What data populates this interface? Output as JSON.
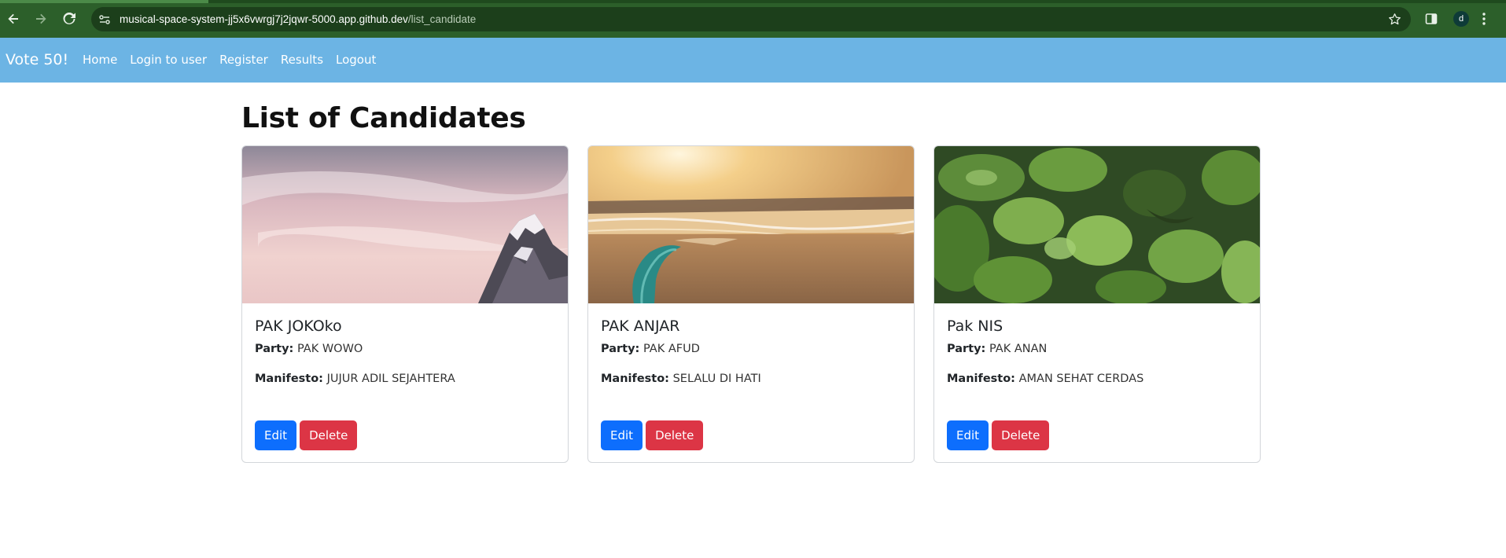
{
  "browser": {
    "url_host": "musical-space-system-jj5x6vwrgj7j2jqwr-5000.app.github.dev",
    "url_path": "/list_candidate",
    "profile_initial": "d",
    "icons": [
      "back-arrow-icon",
      "forward-arrow-icon",
      "reload-icon",
      "site-settings-icon",
      "bookmark-star-icon",
      "side-panel-icon",
      "kebab-menu-icon"
    ]
  },
  "navbar": {
    "brand": "Vote 50!",
    "links": [
      "Home",
      "Login to user",
      "Register",
      "Results",
      "Logout"
    ]
  },
  "page": {
    "title": "List of Candidates"
  },
  "labels": {
    "party": "Party:",
    "manifesto": "Manifesto:",
    "edit": "Edit",
    "delete": "Delete"
  },
  "candidates": [
    {
      "name": "PAK JOKOko",
      "party": "PAK WOWO",
      "manifesto": "JUJUR ADIL SEJAHTERA",
      "image": "snowy-mountain-pink-sky"
    },
    {
      "name": "PAK ANJAR",
      "party": "PAK AFUD",
      "manifesto": "SELALU DI HATI",
      "image": "beach-sunset-surfboard"
    },
    {
      "name": "Pak NIS",
      "party": "PAK ANAN",
      "manifesto": "AMAN SEHAT CERDAS",
      "image": "green-leaves-closeup"
    }
  ],
  "colors": {
    "browser_bar": "#2c5f2a",
    "navbar": "#6cb4e4",
    "edit_button": "#0d6efd",
    "delete_button": "#dc3545"
  }
}
